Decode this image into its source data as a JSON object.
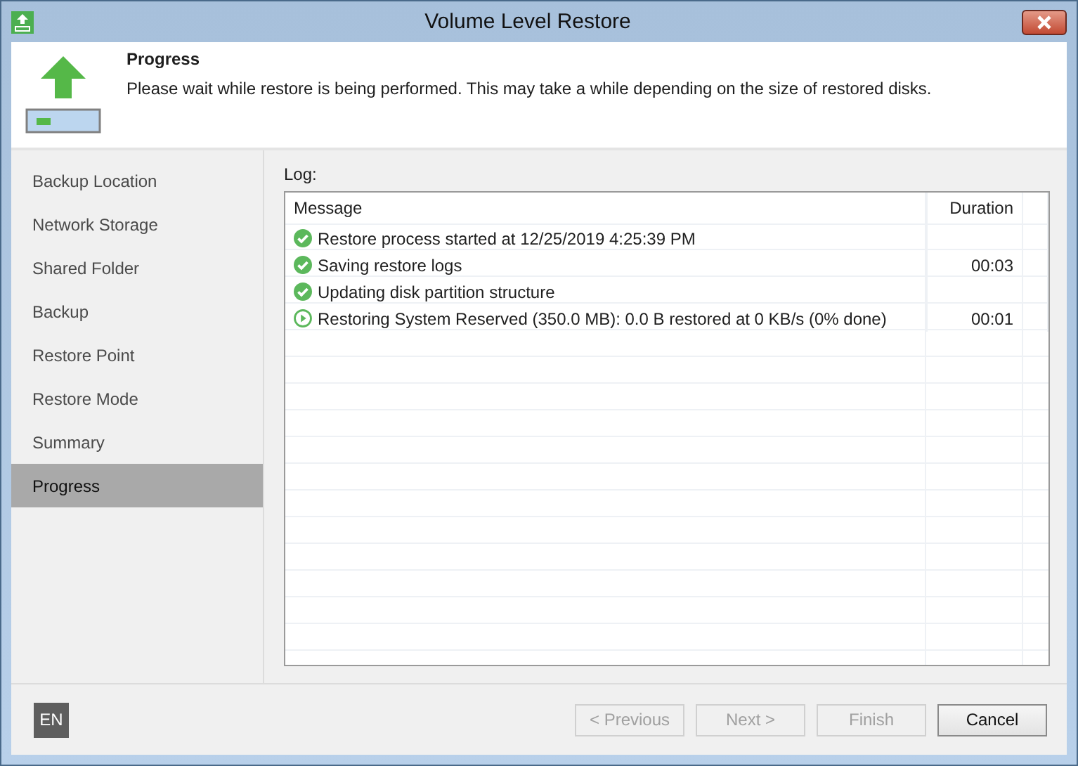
{
  "window": {
    "title": "Volume Level Restore"
  },
  "header": {
    "title": "Progress",
    "description": "Please wait while restore is being performed. This may take a while depending on the size of restored disks."
  },
  "steps": [
    {
      "label": "Backup Location",
      "selected": false
    },
    {
      "label": "Network Storage",
      "selected": false
    },
    {
      "label": "Shared Folder",
      "selected": false
    },
    {
      "label": "Backup",
      "selected": false
    },
    {
      "label": "Restore Point",
      "selected": false
    },
    {
      "label": "Restore Mode",
      "selected": false
    },
    {
      "label": "Summary",
      "selected": false
    },
    {
      "label": "Progress",
      "selected": true
    }
  ],
  "log": {
    "label": "Log:",
    "columns": [
      "Message",
      "Duration"
    ],
    "rows": [
      {
        "kind": "done",
        "message": "Restore process started at 12/25/2019 4:25:39 PM"
      },
      {
        "kind": "done",
        "message": "Saving restore logs",
        "duration": "00:03"
      },
      {
        "kind": "done",
        "message": "Updating disk partition structure"
      },
      {
        "kind": "running",
        "message": "Restoring System Reserved (350.0 MB): 0.0 B restored at 0 KB/s (0% done)",
        "duration": "00:01"
      }
    ]
  },
  "language": "EN",
  "buttons": [
    {
      "label": "< Previous",
      "disabled": true
    },
    {
      "label": "Next >",
      "disabled": true
    },
    {
      "label": "Finish",
      "disabled": true
    },
    {
      "label": "Cancel",
      "disabled": false
    }
  ]
}
